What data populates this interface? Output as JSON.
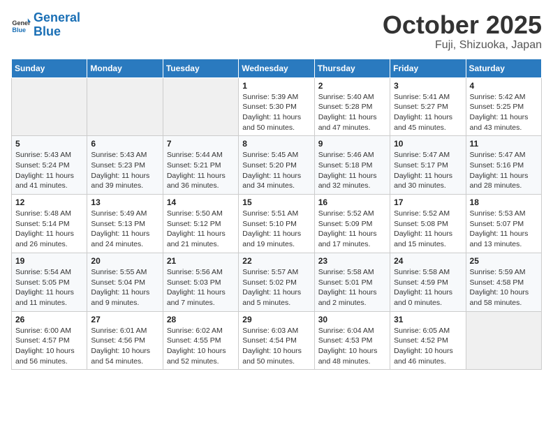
{
  "header": {
    "logo_general": "General",
    "logo_blue": "Blue",
    "title": "October 2025",
    "subtitle": "Fuji, Shizuoka, Japan"
  },
  "weekdays": [
    "Sunday",
    "Monday",
    "Tuesday",
    "Wednesday",
    "Thursday",
    "Friday",
    "Saturday"
  ],
  "weeks": [
    [
      {
        "day": "",
        "info": ""
      },
      {
        "day": "",
        "info": ""
      },
      {
        "day": "",
        "info": ""
      },
      {
        "day": "1",
        "info": "Sunrise: 5:39 AM\nSunset: 5:30 PM\nDaylight: 11 hours\nand 50 minutes."
      },
      {
        "day": "2",
        "info": "Sunrise: 5:40 AM\nSunset: 5:28 PM\nDaylight: 11 hours\nand 47 minutes."
      },
      {
        "day": "3",
        "info": "Sunrise: 5:41 AM\nSunset: 5:27 PM\nDaylight: 11 hours\nand 45 minutes."
      },
      {
        "day": "4",
        "info": "Sunrise: 5:42 AM\nSunset: 5:25 PM\nDaylight: 11 hours\nand 43 minutes."
      }
    ],
    [
      {
        "day": "5",
        "info": "Sunrise: 5:43 AM\nSunset: 5:24 PM\nDaylight: 11 hours\nand 41 minutes."
      },
      {
        "day": "6",
        "info": "Sunrise: 5:43 AM\nSunset: 5:23 PM\nDaylight: 11 hours\nand 39 minutes."
      },
      {
        "day": "7",
        "info": "Sunrise: 5:44 AM\nSunset: 5:21 PM\nDaylight: 11 hours\nand 36 minutes."
      },
      {
        "day": "8",
        "info": "Sunrise: 5:45 AM\nSunset: 5:20 PM\nDaylight: 11 hours\nand 34 minutes."
      },
      {
        "day": "9",
        "info": "Sunrise: 5:46 AM\nSunset: 5:18 PM\nDaylight: 11 hours\nand 32 minutes."
      },
      {
        "day": "10",
        "info": "Sunrise: 5:47 AM\nSunset: 5:17 PM\nDaylight: 11 hours\nand 30 minutes."
      },
      {
        "day": "11",
        "info": "Sunrise: 5:47 AM\nSunset: 5:16 PM\nDaylight: 11 hours\nand 28 minutes."
      }
    ],
    [
      {
        "day": "12",
        "info": "Sunrise: 5:48 AM\nSunset: 5:14 PM\nDaylight: 11 hours\nand 26 minutes."
      },
      {
        "day": "13",
        "info": "Sunrise: 5:49 AM\nSunset: 5:13 PM\nDaylight: 11 hours\nand 24 minutes."
      },
      {
        "day": "14",
        "info": "Sunrise: 5:50 AM\nSunset: 5:12 PM\nDaylight: 11 hours\nand 21 minutes."
      },
      {
        "day": "15",
        "info": "Sunrise: 5:51 AM\nSunset: 5:10 PM\nDaylight: 11 hours\nand 19 minutes."
      },
      {
        "day": "16",
        "info": "Sunrise: 5:52 AM\nSunset: 5:09 PM\nDaylight: 11 hours\nand 17 minutes."
      },
      {
        "day": "17",
        "info": "Sunrise: 5:52 AM\nSunset: 5:08 PM\nDaylight: 11 hours\nand 15 minutes."
      },
      {
        "day": "18",
        "info": "Sunrise: 5:53 AM\nSunset: 5:07 PM\nDaylight: 11 hours\nand 13 minutes."
      }
    ],
    [
      {
        "day": "19",
        "info": "Sunrise: 5:54 AM\nSunset: 5:05 PM\nDaylight: 11 hours\nand 11 minutes."
      },
      {
        "day": "20",
        "info": "Sunrise: 5:55 AM\nSunset: 5:04 PM\nDaylight: 11 hours\nand 9 minutes."
      },
      {
        "day": "21",
        "info": "Sunrise: 5:56 AM\nSunset: 5:03 PM\nDaylight: 11 hours\nand 7 minutes."
      },
      {
        "day": "22",
        "info": "Sunrise: 5:57 AM\nSunset: 5:02 PM\nDaylight: 11 hours\nand 5 minutes."
      },
      {
        "day": "23",
        "info": "Sunrise: 5:58 AM\nSunset: 5:01 PM\nDaylight: 11 hours\nand 2 minutes."
      },
      {
        "day": "24",
        "info": "Sunrise: 5:58 AM\nSunset: 4:59 PM\nDaylight: 11 hours\nand 0 minutes."
      },
      {
        "day": "25",
        "info": "Sunrise: 5:59 AM\nSunset: 4:58 PM\nDaylight: 10 hours\nand 58 minutes."
      }
    ],
    [
      {
        "day": "26",
        "info": "Sunrise: 6:00 AM\nSunset: 4:57 PM\nDaylight: 10 hours\nand 56 minutes."
      },
      {
        "day": "27",
        "info": "Sunrise: 6:01 AM\nSunset: 4:56 PM\nDaylight: 10 hours\nand 54 minutes."
      },
      {
        "day": "28",
        "info": "Sunrise: 6:02 AM\nSunset: 4:55 PM\nDaylight: 10 hours\nand 52 minutes."
      },
      {
        "day": "29",
        "info": "Sunrise: 6:03 AM\nSunset: 4:54 PM\nDaylight: 10 hours\nand 50 minutes."
      },
      {
        "day": "30",
        "info": "Sunrise: 6:04 AM\nSunset: 4:53 PM\nDaylight: 10 hours\nand 48 minutes."
      },
      {
        "day": "31",
        "info": "Sunrise: 6:05 AM\nSunset: 4:52 PM\nDaylight: 10 hours\nand 46 minutes."
      },
      {
        "day": "",
        "info": ""
      }
    ]
  ]
}
